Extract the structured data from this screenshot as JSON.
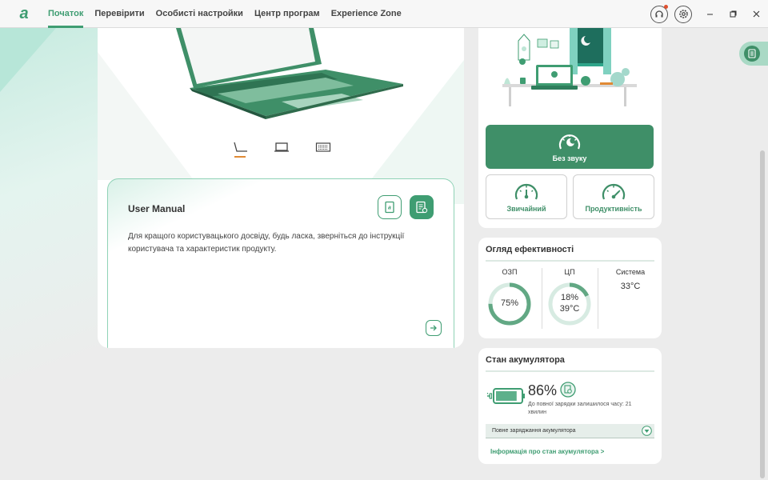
{
  "nav": {
    "items": [
      {
        "label": "Початок"
      },
      {
        "label": "Перевірити"
      },
      {
        "label": "Особисті настройки"
      },
      {
        "label": "Центр програм"
      },
      {
        "label": "Experience Zone"
      }
    ]
  },
  "manual": {
    "title": "User Manual",
    "text": "Для кращого користувацького досвіду, будь ласка, зверніться до інструкції користувача та характеристик продукту."
  },
  "modes": {
    "silent": "Без звуку",
    "normal": "Звичайний",
    "performance": "Продуктивність"
  },
  "performance": {
    "title": "Огляд ефективності",
    "ram_label": "ОЗП",
    "ram_value": "75%",
    "ram_fraction": 0.75,
    "cpu_label": "ЦП",
    "cpu_usage": "18%",
    "cpu_temp": "39°C",
    "cpu_fraction": 0.18,
    "system_label": "Система",
    "system_temp": "33°C"
  },
  "battery": {
    "title": "Стан акумулятора",
    "percent": "86%",
    "level": 0.86,
    "remaining": "До повної зарядки залишилося часу: 21 хвилин",
    "mode": "Повне заряджання акумулятора",
    "info_link": "Інформація про стан акумулятора >"
  },
  "colors": {
    "accent": "#3f9d72",
    "accent_dark": "#3f8f68"
  }
}
